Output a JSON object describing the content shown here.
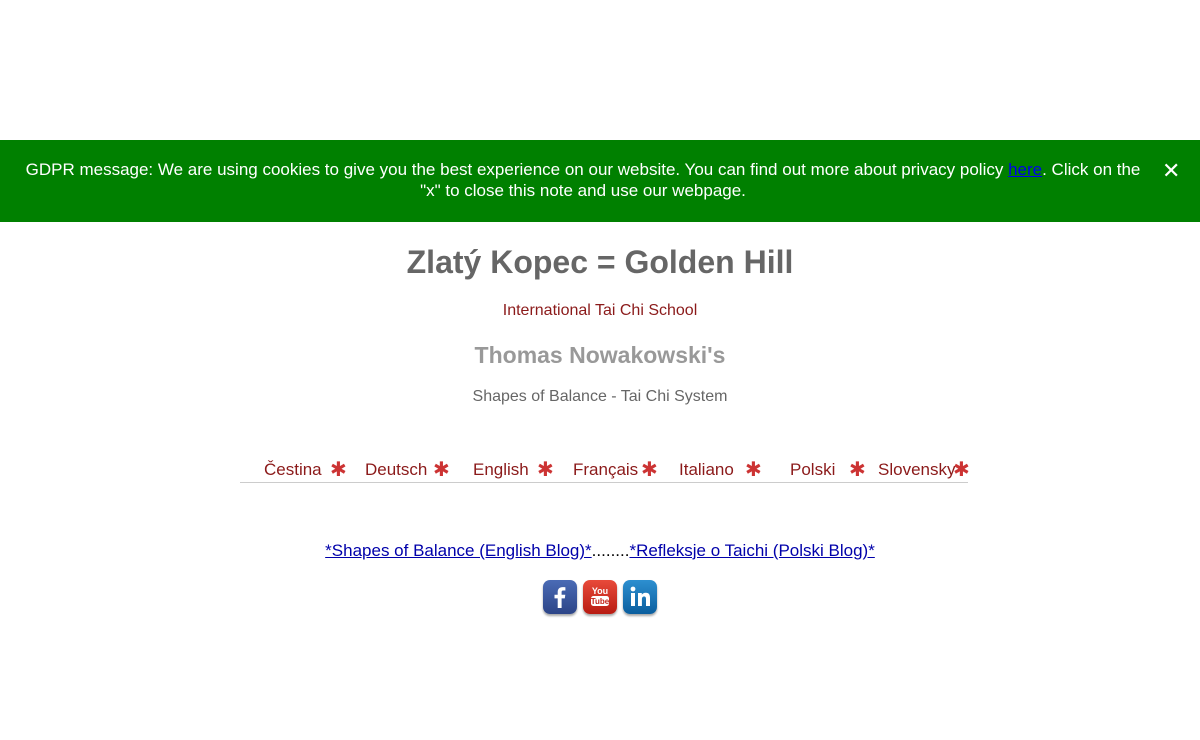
{
  "gdpr": {
    "text_before": "GDPR message: We are using cookies to give you the best experience on our website. You can find out more about privacy policy ",
    "link_text": "here",
    "text_after": ". Click on the \"x\" to close this note and use our webpage.",
    "close_label": "✕"
  },
  "header": {
    "title": "Zlatý Kopec = Golden Hill",
    "subtitle": "International Tai Chi School",
    "author": "Thomas Nowakowski's",
    "system": "Shapes of Balance - Tai Chi System"
  },
  "languages": [
    "Čestina",
    "Deutsch",
    "English",
    "Français",
    "Italiano",
    "Polski",
    "Slovensky"
  ],
  "language_separator": "✱",
  "blogs": {
    "english": "*Shapes of Balance (English Blog)*",
    "separator": "........",
    "polish": "*Refleksje o Taichi (Polski Blog)*"
  },
  "social": [
    {
      "name": "facebook-icon",
      "glyph": "f"
    },
    {
      "name": "youtube-icon",
      "glyph": "You Tube"
    },
    {
      "name": "linkedin-icon",
      "glyph": "in"
    }
  ],
  "colors": {
    "banner": "#008000",
    "title": "#666666",
    "accent": "#8b1a1a",
    "star": "#cc3333"
  }
}
